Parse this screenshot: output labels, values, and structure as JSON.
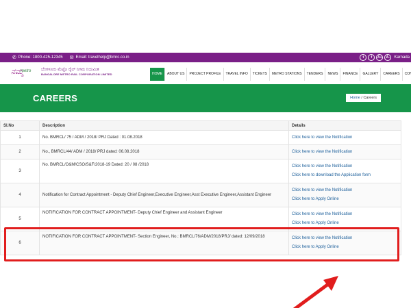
{
  "topbar": {
    "phone": "Phone: 1800-425-12345",
    "email": "Email: travelhelp@bmrc.co.in",
    "social": [
      "t",
      "f",
      "A+",
      "A-"
    ],
    "language": "Karnada"
  },
  "logo": {
    "script": "ನಮ್ಮ",
    "sub": "metro",
    "kannada": "ಬೆಂಗಳೂರು ಮೆಟ್ರೊ ರೈಲ್ ನಿಗಮ ನಿಯಮಿತ",
    "english": "BANGALORE METRO RAIL CORPORATION LIMITED"
  },
  "nav": [
    "HOME",
    "ABOUT US",
    "PROJECT PROFILE",
    "TRAVEL INFO",
    "TICKETS",
    "METRO STATIONS",
    "TENDERS",
    "NEWS",
    "FINANCE",
    "GALLERY",
    "CAREERS",
    "CONTACT US"
  ],
  "banner": {
    "title": "CAREERS",
    "breadcrumb_home": "Home",
    "breadcrumb_sep": "/",
    "breadcrumb_current": "Careers"
  },
  "table": {
    "headers": [
      "Sl.No",
      "Description",
      "Details"
    ],
    "rows": [
      {
        "sl": "1",
        "desc": "No. BMRCL/ 75 / ADM / 2018/ PRJ Dated : 01.08.2018",
        "links": [
          "Click here to view the Notification"
        ]
      },
      {
        "sl": "2",
        "desc": "No., BMRCL/44/ ADM / 2018/ PRJ dated: 06.08.2018",
        "links": [
          "Click here to view the Notification"
        ]
      },
      {
        "sl": "3",
        "desc": "No. BMRCL/O&M/CSO/S&F/2018-19 Dated: 20 / 08 /2018",
        "links": [
          "Click here to view the Notification",
          "Click here to download the Application form"
        ]
      },
      {
        "sl": "4",
        "desc": "Notification for Contract Appointment - Deputy Chief Engineer,Executive Engineer,Asst Executive Engineer,Assistant Engineer",
        "links": [
          "Click here to view the Notification",
          "Click here to Apply Online"
        ]
      },
      {
        "sl": "5",
        "desc": "NOTIFICATION FOR CONTRACT APPOINTMENT- Deputy Chief Engineer and Assistant Engineer",
        "links": [
          "Click here to view the Notification",
          "Click here to Apply Online"
        ]
      },
      {
        "sl": "6",
        "desc": "NOTIFICATION FOR CONTRACT APPOINTMENT- Section Engineer, No.: BMRCL/76/ADM/2018/PRJ/ dated: 12/09/2018",
        "links": [
          "Click here to view the Notification",
          "Click here to Apply Online"
        ]
      }
    ]
  },
  "colors": {
    "topbar": "#7a1f87",
    "brand_green": "#16954a",
    "link": "#1b5e9a",
    "highlight": "#e11d1d"
  }
}
